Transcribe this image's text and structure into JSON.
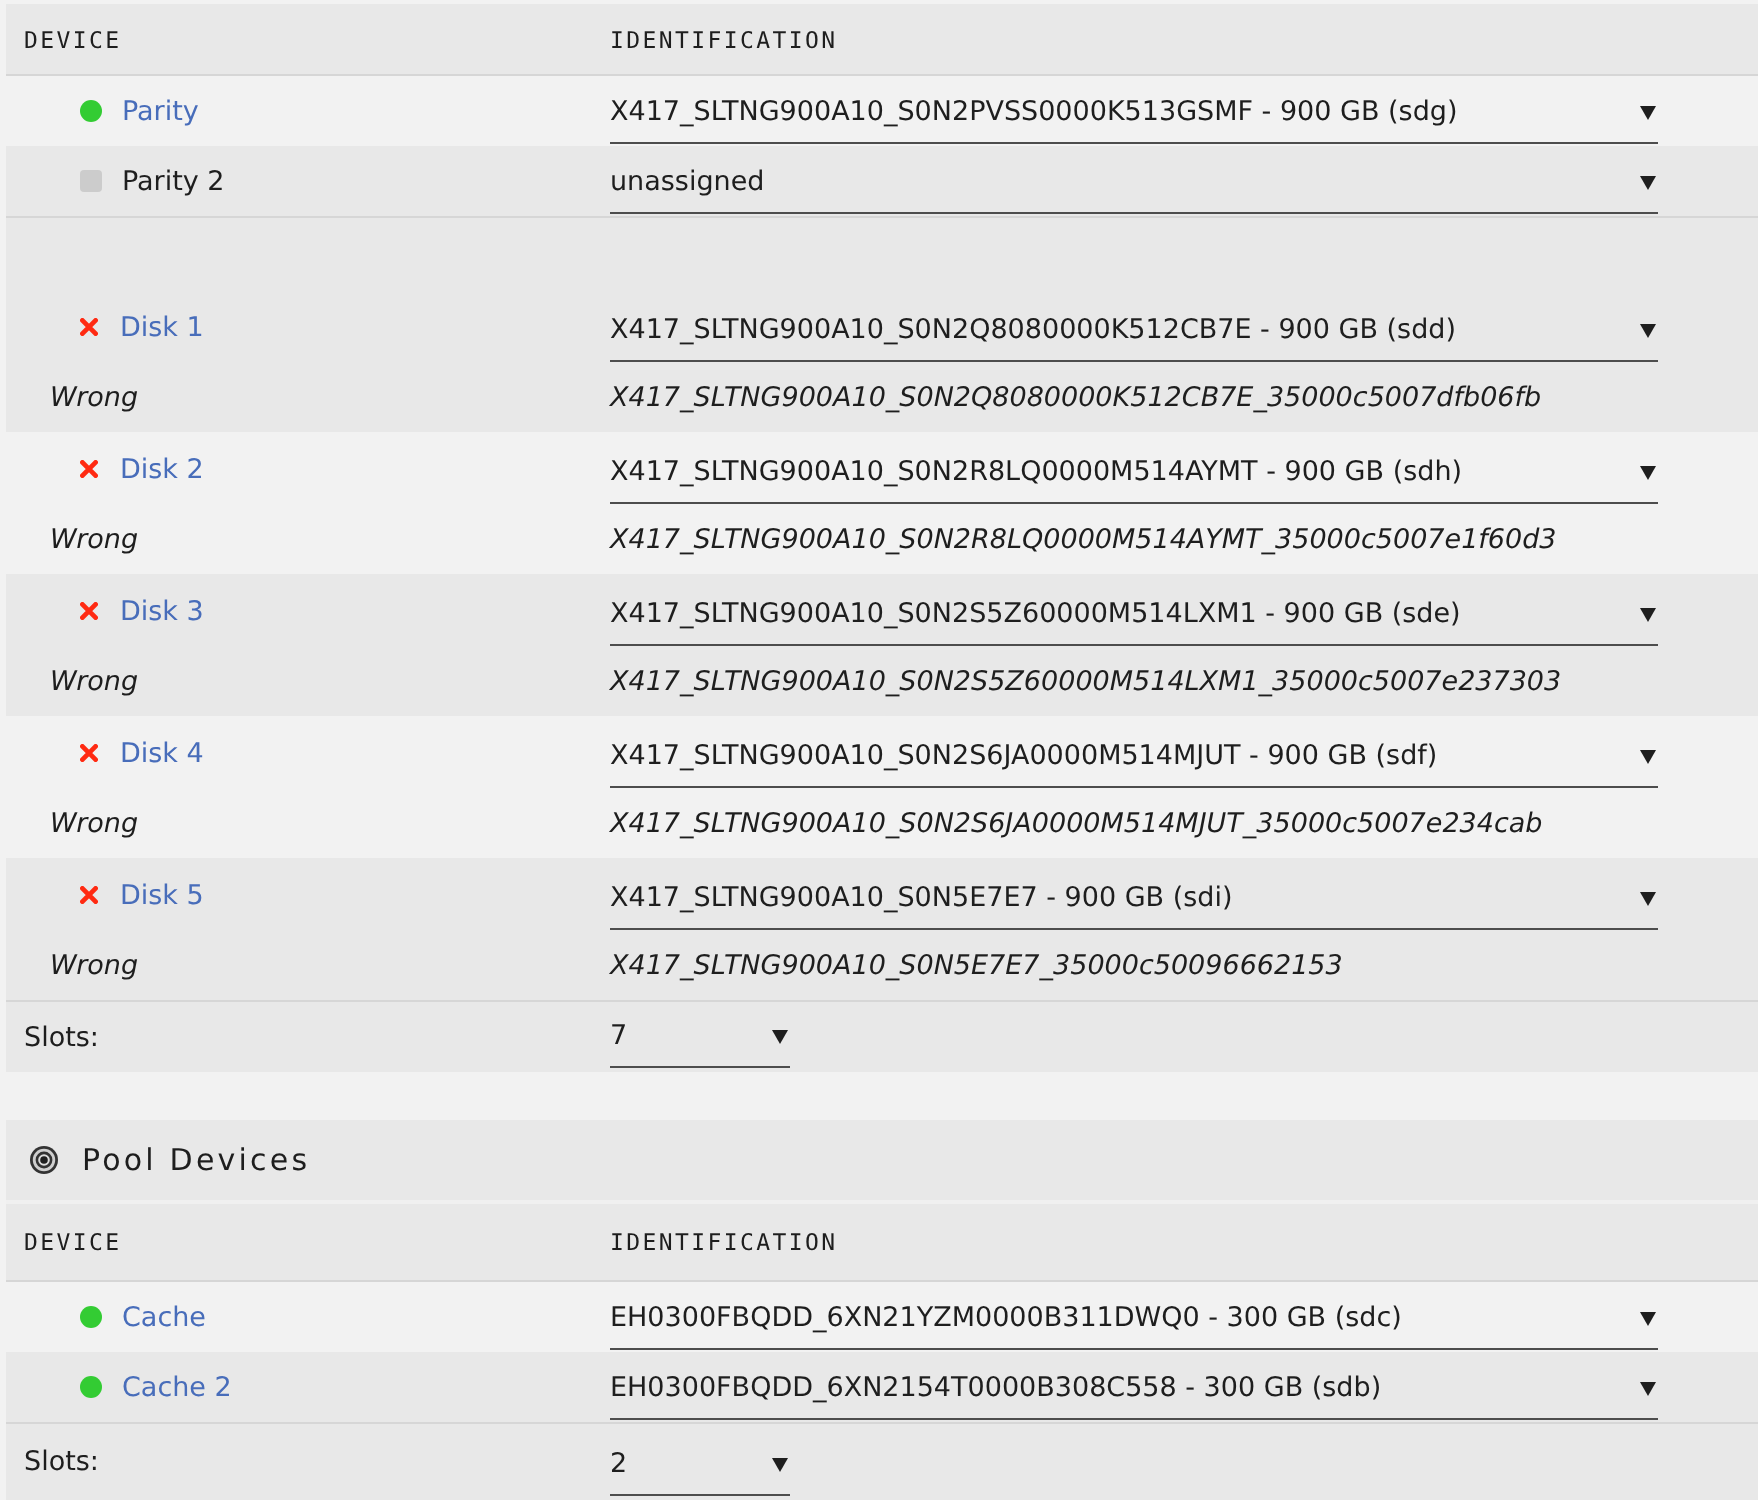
{
  "array_devices": {
    "columns": [
      "DEVICE",
      "IDENTIFICATION"
    ],
    "parity_rows": [
      {
        "name": "Parity",
        "kind": "online",
        "identification": "X417_SLTNG900A10_S0N2PVSS0000K513GSMF - 900 GB (sdg)"
      },
      {
        "name": "Parity 2",
        "kind": "unassigned",
        "identification": "unassigned"
      }
    ],
    "disk_rows": [
      {
        "name": "Disk 1",
        "kind": "wrong",
        "identification": "X417_SLTNG900A10_S0N2Q8080000K512CB7E - 900 GB (sdd)",
        "note": "Wrong",
        "expected": "X417_SLTNG900A10_S0N2Q8080000K512CB7E_35000c5007dfb06fb"
      },
      {
        "name": "Disk 2",
        "kind": "wrong",
        "identification": "X417_SLTNG900A10_S0N2R8LQ0000M514AYMT - 900 GB (sdh)",
        "note": "Wrong",
        "expected": "X417_SLTNG900A10_S0N2R8LQ0000M514AYMT_35000c5007e1f60d3"
      },
      {
        "name": "Disk 3",
        "kind": "wrong",
        "identification": "X417_SLTNG900A10_S0N2S5Z60000M514LXM1 - 900 GB (sde)",
        "note": "Wrong",
        "expected": "X417_SLTNG900A10_S0N2S5Z60000M514LXM1_35000c5007e237303"
      },
      {
        "name": "Disk 4",
        "kind": "wrong",
        "identification": "X417_SLTNG900A10_S0N2S6JA0000M514MJUT - 900 GB (sdf)",
        "note": "Wrong",
        "expected": "X417_SLTNG900A10_S0N2S6JA0000M514MJUT_35000c5007e234cab"
      },
      {
        "name": "Disk 5",
        "kind": "wrong",
        "identification": "X417_SLTNG900A10_S0N5E7E7 - 900 GB (sdi)",
        "note": "Wrong",
        "expected": "X417_SLTNG900A10_S0N5E7E7_35000c50096662153"
      }
    ],
    "slots": {
      "label": "Slots:",
      "value": "7"
    }
  },
  "pool_devices": {
    "title": "Pool Devices",
    "columns": [
      "DEVICE",
      "IDENTIFICATION"
    ],
    "rows": [
      {
        "name": "Cache",
        "kind": "online",
        "identification": "EH0300FBQDD_6XN21YZM0000B311DWQ0 - 300 GB (sdc)"
      },
      {
        "name": "Cache 2",
        "kind": "online",
        "identification": "EH0300FBQDD_6XN2154T0000B308C558 - 300 GB (sdb)"
      }
    ],
    "slots": {
      "label": "Slots:",
      "value": "2"
    }
  }
}
